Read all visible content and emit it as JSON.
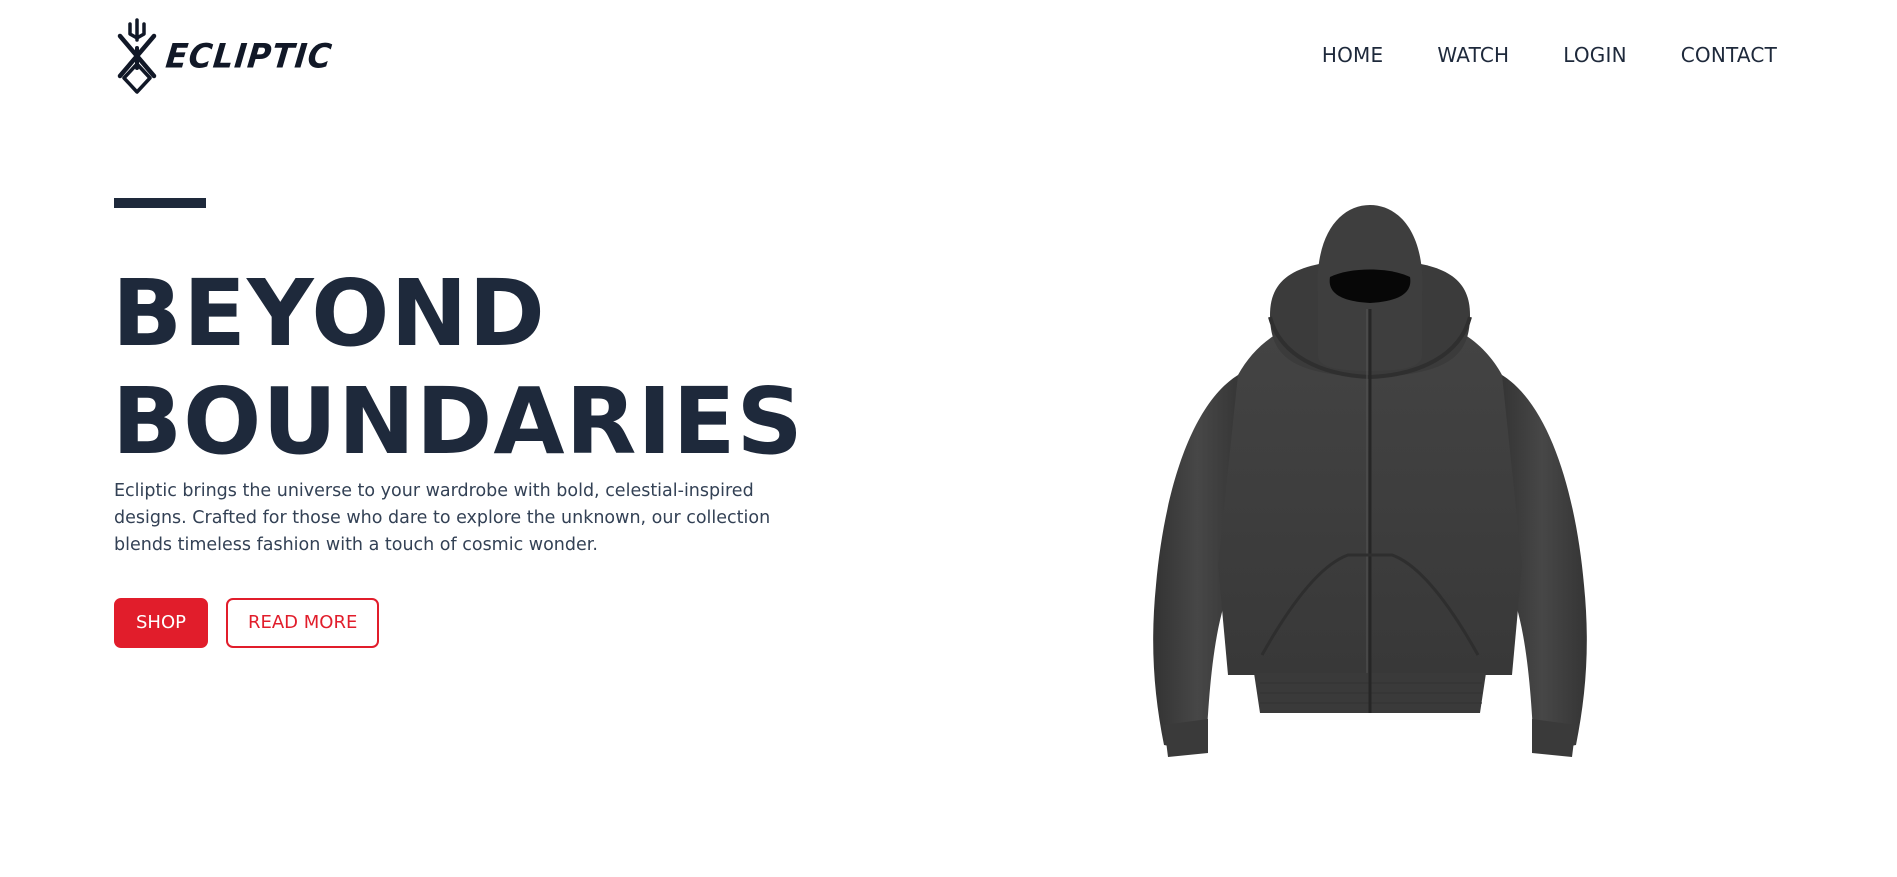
{
  "brand": {
    "name": "ECLIPTIC",
    "logo_icon": "brand-sigil-icon"
  },
  "nav": {
    "items": [
      {
        "label": "HOME"
      },
      {
        "label": "WATCH"
      },
      {
        "label": "LOGIN"
      },
      {
        "label": "CONTACT"
      }
    ]
  },
  "hero": {
    "title_line1": "BEYOND",
    "title_line2": "BOUNDARIES",
    "description": "Ecliptic brings the universe to your wardrobe with bold, celestial-inspired designs. Crafted for those who dare to explore the unknown, our collection blends timeless fashion with a touch of cosmic wonder.",
    "primary_button": "SHOP",
    "secondary_button": "READ MORE",
    "product_image": "hoodie-image"
  },
  "colors": {
    "accent": "#e11d2b",
    "text_dark": "#1e293b",
    "product_fabric": "#3f3f3f"
  }
}
